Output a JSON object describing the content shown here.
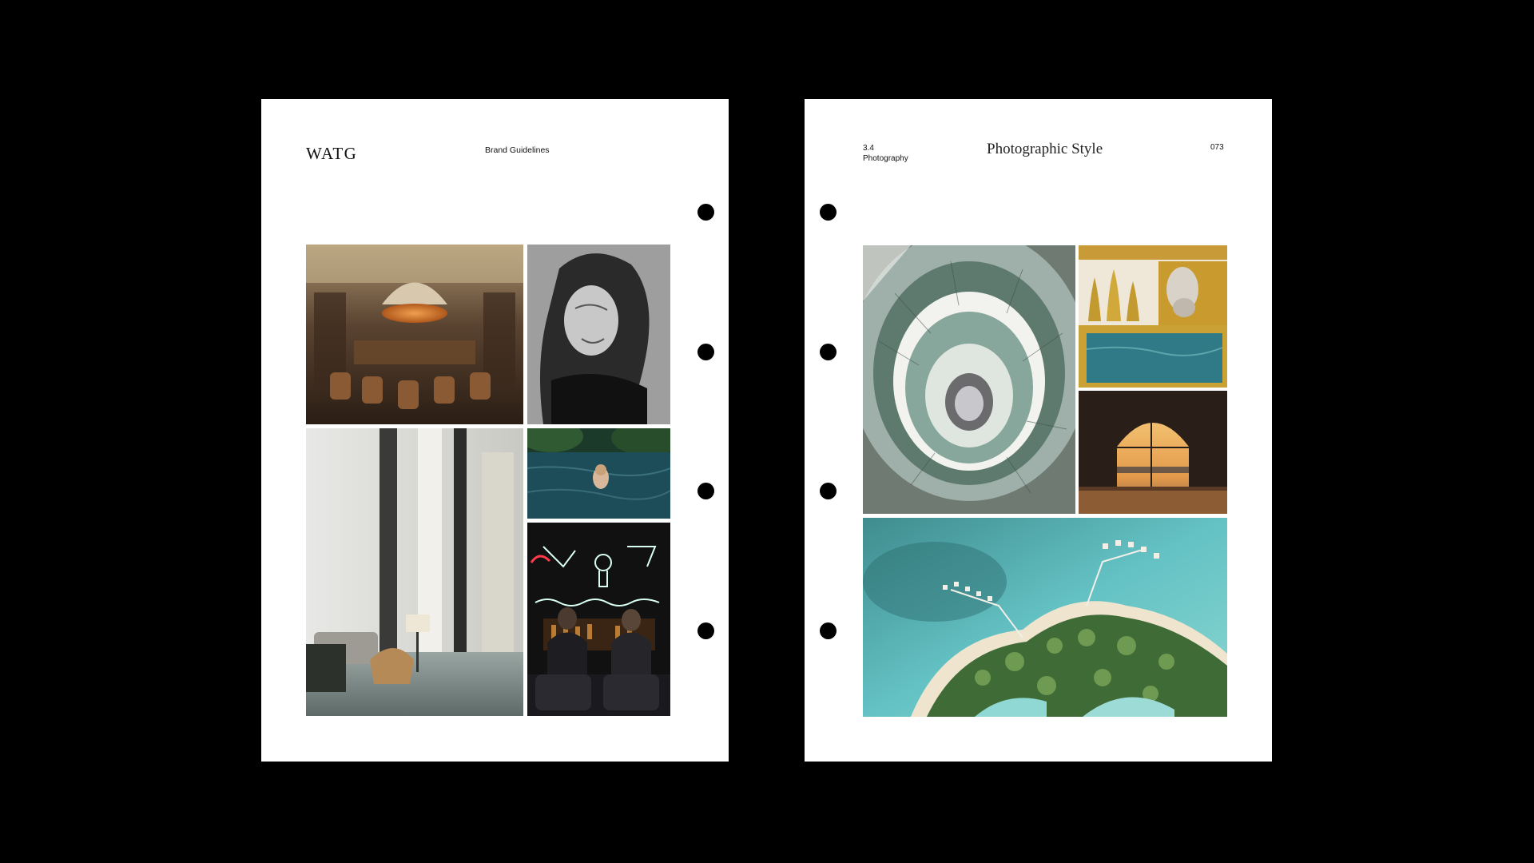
{
  "left_page": {
    "logo": "WATG",
    "doc_title": "Brand Guidelines",
    "photos": [
      {
        "name": "restaurant-dining-room",
        "subject": "restaurant dining room with dome pendant lamp"
      },
      {
        "name": "woman-portrait",
        "subject": "black and white portrait of smiling woman"
      },
      {
        "name": "hotel-lobby",
        "subject": "marble hotel lobby with sofa and lamp"
      },
      {
        "name": "pool-swimmer",
        "subject": "swimmer in dark pool among foliage"
      },
      {
        "name": "neon-bar",
        "subject": "bar with neon signs and two guests"
      }
    ]
  },
  "right_page": {
    "section_number": "3.4",
    "section_name": "Photography",
    "heading": "Photographic Style",
    "page_number": "073",
    "photos": [
      {
        "name": "spiral-staircase",
        "subject": "spiral staircase viewed from above"
      },
      {
        "name": "indoor-pool-gold",
        "subject": "gold indoor pool with classical bust"
      },
      {
        "name": "arch-window-sunset",
        "subject": "arched window overlooking sunset sea"
      },
      {
        "name": "island-resort-aerial",
        "subject": "aerial view of island resort with overwater villas"
      }
    ]
  },
  "colors": {
    "background": "#000000",
    "page": "#ffffff",
    "ink": "#111111"
  }
}
